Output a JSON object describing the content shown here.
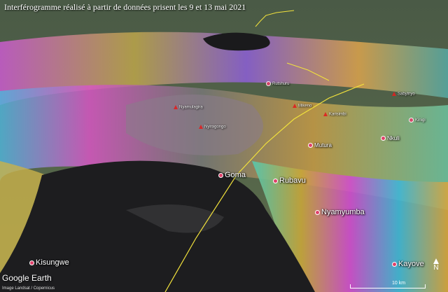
{
  "caption": "Interférogramme réalisé à partir de données prisent les 9 et 13 mai 2021",
  "places": {
    "goma": "Goma",
    "rubavu": "Rubavu",
    "nyamyumba": "Nyamyumba",
    "kisungwe": "Kisungwe",
    "kayove": "Kayove",
    "mutura": "Mutura",
    "nkuli": "Nkuli",
    "kinigi": "Kinigi",
    "nyiragongo": "Nyiragongo",
    "nyamulagira": "Nyamulagira",
    "mikeno": "Mikeno",
    "karisimbi": "Karisimbi",
    "rutshuru": "Rutshuru",
    "sabyinyo": "Sabyinyo"
  },
  "branding": {
    "logo": "Google Earth",
    "attribution": "Image Landsat / Copernicus"
  },
  "scale_label": "10 km",
  "compass_label": "N",
  "colors": {
    "lake": "#1d1d1f",
    "border_line": "#f2e23c",
    "marker": "#e0406a"
  }
}
